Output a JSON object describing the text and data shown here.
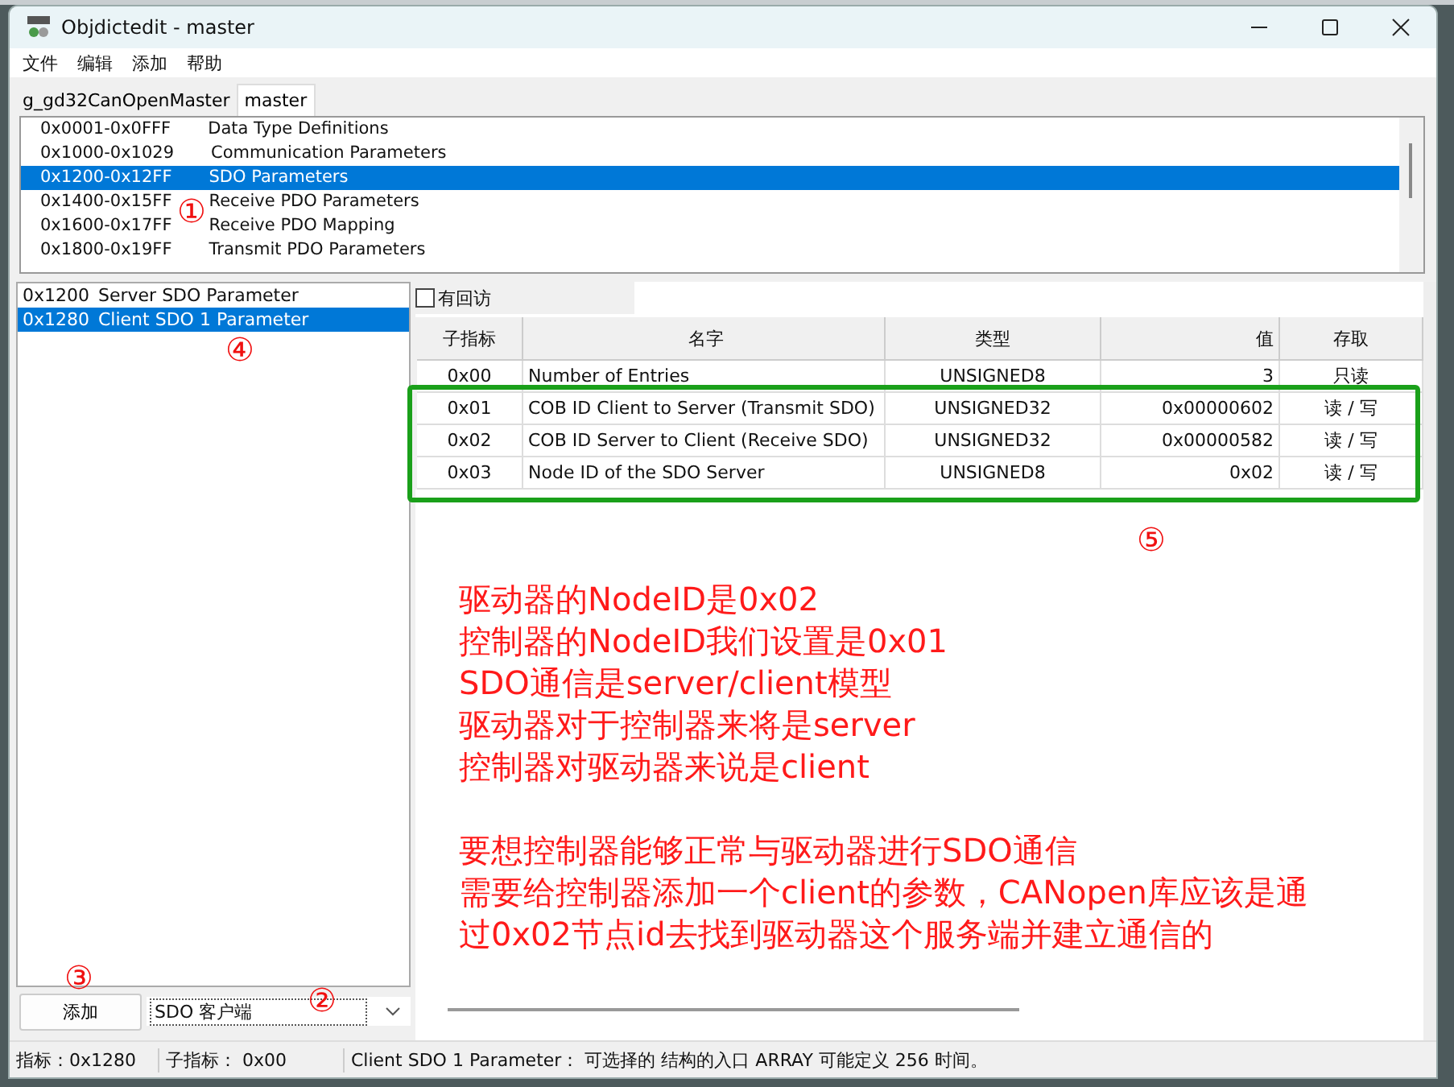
{
  "window": {
    "title": "Objdictedit - master"
  },
  "menu": [
    "文件",
    "编辑",
    "添加",
    "帮助"
  ],
  "tabs": [
    {
      "label": "g_gd32CanOpenMaster",
      "selected": false
    },
    {
      "label": "master",
      "selected": true
    }
  ],
  "index_ranges": [
    {
      "range": "0x0001-0x0FFF",
      "name": "Data Type Definitions",
      "selected": false
    },
    {
      "range": "0x1000-0x1029",
      "name": "Communication Parameters",
      "selected": false
    },
    {
      "range": "0x1200-0x12FF",
      "name": "SDO Parameters",
      "selected": true
    },
    {
      "range": "0x1400-0x15FF",
      "name": "Receive PDO Parameters",
      "selected": false
    },
    {
      "range": "0x1600-0x17FF",
      "name": "Receive PDO Mapping",
      "selected": false
    },
    {
      "range": "0x1800-0x19FF",
      "name": "Transmit PDO Parameters",
      "selected": false
    }
  ],
  "entries": [
    {
      "index": "0x1200",
      "name": "Server SDO Parameter",
      "selected": false
    },
    {
      "index": "0x1280",
      "name": "Client SDO 1 Parameter",
      "selected": true
    }
  ],
  "add_button": "添加",
  "type_select": {
    "value": "SDO 客户端"
  },
  "checkbox": {
    "label": "有回访",
    "checked": false
  },
  "table": {
    "columns": [
      "子指标",
      "名字",
      "类型",
      "值",
      "存取"
    ],
    "rows": [
      {
        "subindex": "0x00",
        "name": "Number of Entries",
        "type": "UNSIGNED8",
        "value": "3",
        "access": "只读"
      },
      {
        "subindex": "0x01",
        "name": "COB ID Client to Server (Transmit SDO)",
        "type": "UNSIGNED32",
        "value": "0x00000602",
        "access": "读 / 写"
      },
      {
        "subindex": "0x02",
        "name": "COB ID Server to Client (Receive SDO)",
        "type": "UNSIGNED32",
        "value": "0x00000582",
        "access": "读 / 写"
      },
      {
        "subindex": "0x03",
        "name": "Node ID of the SDO Server",
        "type": "UNSIGNED8",
        "value": "0x02",
        "access": "读 / 写"
      }
    ]
  },
  "annotations": {
    "markers": [
      "①",
      "②",
      "③",
      "④",
      "⑤"
    ],
    "note_lines": [
      "驱动器的NodeID是0x02",
      "控制器的NodeID我们设置是0x01",
      "SDO通信是server/client模型",
      "驱动器对于控制器来将是server",
      "控制器对驱动器来说是client",
      "要想控制器能够正常与驱动器进行SDO通信",
      "需要给控制器添加一个client的参数，CANopen库应该是通",
      "过0x02节点id去找到驱动器这个服务端并建立通信的"
    ]
  },
  "status_bar": [
    "指标：0x1280",
    "子指标： 0x00",
    "Client SDO 1 Parameter：  可选择的 结构的入口 ARRAY 可能定义 256 时间。"
  ]
}
